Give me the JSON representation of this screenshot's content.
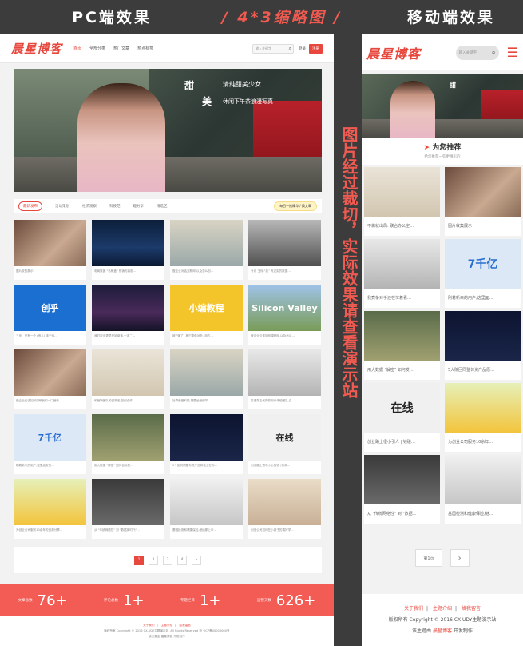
{
  "headings": {
    "pc": "PC端效果",
    "middle": "/ 4*3缩略图 /",
    "mobile": "移动端效果"
  },
  "side_note": "图片经过裁切，实际效果请查看演示站",
  "colors": {
    "accent": "#e8473d",
    "stats_bg": "#f25c55",
    "dark_bg": "#3c3c3c"
  },
  "pc": {
    "logo": "晨星博客",
    "nav": [
      "首页",
      "全部分类",
      "热门文章",
      "热点标签"
    ],
    "search_placeholder": "输入关键字",
    "login": "登录",
    "register": "注册",
    "banner": {
      "line1": "甜",
      "line2": "清纯甜美少女",
      "line3": "美",
      "line4": "休闲下午茶浪漫写真"
    },
    "tabs": [
      "最新发布",
      "活动策划",
      "经济观察",
      "科技范",
      "趣分享",
      "精选区"
    ],
    "tab_note": "每日一推精华 / 换文章",
    "cards": [
      {
        "art": "art-red",
        "caption": "图片收集展示"
      },
      {
        "art": "art-night",
        "caption": "电商集团 \"马桶盖\" 热销的真相…"
      },
      {
        "art": "art-man",
        "caption": "做企业对话互联网,以及怎么创…"
      },
      {
        "art": "art-bw",
        "caption": "专访 王伟:\"英\" 有过实的数据…"
      },
      {
        "art": "art-blue",
        "caption": "三步、只有一个 (有人) 该于你…",
        "overlay": "创乎"
      },
      {
        "art": "art-stage",
        "caption": "我们应该更早开始阅读,一本二…"
      },
      {
        "art": "art-yellow",
        "caption": "被 \"骗了\" 其它要像对外, 用力…",
        "overlay": "小编教程"
      },
      {
        "art": "art-green",
        "caption": "做企业应该如何调研网,以及怎么…",
        "overlay": "Silicon Valley"
      },
      {
        "art": "art-red",
        "caption": "做企业应该如何调研我们一门营商…"
      },
      {
        "art": "art-mic",
        "caption": "和营销团队的创新者,如何合作…"
      },
      {
        "art": "art-man",
        "caption": "社群就做科技,需要运营的节…"
      },
      {
        "art": "art-laptop",
        "caption": "打造真正优秀的用户体验团队,自…"
      },
      {
        "art": "art-white",
        "caption": "刚着新来的用户,这里面有些…",
        "overlay": "7千亿"
      },
      {
        "art": "art-money",
        "caption": "用大数据 \"解密\" 如何自动发…"
      },
      {
        "art": "art-dark",
        "caption": "5个如何同整有资产品和营业在你…"
      },
      {
        "art": "art-ink",
        "caption": "创业路上很不小心的钱 (有效…",
        "overlay": "在线"
      },
      {
        "art": "art-cubes",
        "caption": "为创业公司服务10余年的资源分享…"
      },
      {
        "art": "art-park",
        "caption": "从 \"传统网络性\" 到 \"数据库时代\"…"
      },
      {
        "art": "art-phone",
        "caption": "基因检测和健康保险,继续那上市…"
      },
      {
        "art": "art-baby",
        "caption": "创业公司如何在小孩子的喜好学…"
      }
    ],
    "pages": [
      "1",
      "2",
      "3",
      "4",
      "»"
    ],
    "stats": [
      {
        "label": "文章总数",
        "value": "76+"
      },
      {
        "label": "评论总数",
        "value": "1+"
      },
      {
        "label": "专题栏目",
        "value": "1+"
      },
      {
        "label": "运营天数",
        "value": "626+"
      }
    ],
    "footer_links": [
      "关于我们",
      "主题介绍",
      "给我留言"
    ],
    "footer_copy": "版权所有 Copyright © 2016 CX-UDY主题演示站 ,All Rights Reserved 浙 · ICP备00000000号",
    "footer_credit": "该主题由 晨星博客 开发制作"
  },
  "mobile": {
    "logo": "晨星博客",
    "search_placeholder": "输入关键字",
    "banner_tag": "甜",
    "rec_title": "为您推荐",
    "rec_sub": "给您推荐一些更精彩的",
    "cards": [
      {
        "art": "art-mic",
        "caption": "不做就出局: 联合办公空…"
      },
      {
        "art": "art-red",
        "caption": "图片收集展示"
      },
      {
        "art": "art-laptop",
        "caption": "我竟争对手还在忙着看…"
      },
      {
        "art": "art-white",
        "caption": "刚着新来的用户,这里面…",
        "overlay": "7千亿"
      },
      {
        "art": "art-money",
        "caption": "用大数据 \"解密\" 如何发…"
      },
      {
        "art": "art-dark",
        "caption": "5大院回同整体资产品原…"
      },
      {
        "art": "art-ink",
        "caption": "创业路上很小引人 | 钱碰…",
        "overlay": "在线"
      },
      {
        "art": "art-cubes",
        "caption": "为创业公司服务10余年…"
      },
      {
        "art": "art-park",
        "caption": "从 \"传统网络性\" 到 \"数据…"
      },
      {
        "art": "art-phone",
        "caption": "基因检测和健康保险,继…"
      }
    ],
    "page_label": "第1页",
    "next_label": "›",
    "footer_links": [
      "关于我们",
      "主题介绍",
      "给我留言"
    ],
    "footer_copy": "版权所有 Copyright © 2016 CX-UDY主题演示站",
    "footer_credit_pre": "该主题由",
    "footer_credit_brand": "晨星博客",
    "footer_credit_post": "开发制作"
  }
}
